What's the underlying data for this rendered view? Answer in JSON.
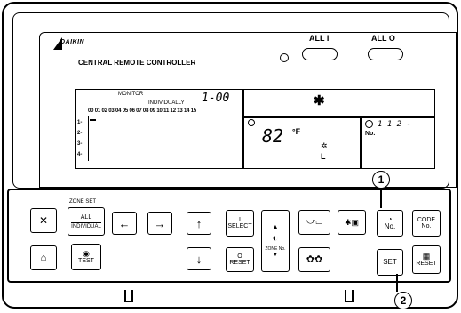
{
  "brand": "DAIKIN",
  "product_title": "CENTRAL REMOTE CONTROLLER",
  "all_on_label": "ALL I",
  "all_off_label": "ALL O",
  "lcd": {
    "monitor_label": "MONITOR",
    "individually_label": "INDIVIDUALLY",
    "group_display": "1-00",
    "zone_numbers": "00 01 02 03 04 05 06 07 08 09 10 11 12 13 14 15",
    "rows": [
      "1-",
      "2-",
      "3-",
      "4-"
    ],
    "star": "✱",
    "temperature": "82",
    "temp_unit": "°F",
    "fan_level": "L",
    "no_label": "No.",
    "program_display": "1  1 2 -"
  },
  "buttons": {
    "zone_set_title": "ZONE SET",
    "all_label": "ALL",
    "individual_label": "INDIVIDUAL",
    "test_label": "TEST",
    "left_arrow": "←",
    "right_arrow": "→",
    "up_arrow": "↑",
    "down_arrow": "↓",
    "select_label": "SELECT",
    "select_mark": "I",
    "reset_label": "RESET",
    "reset_mark": "O",
    "zone_no_label": "ZONE No.",
    "up_tri": "▲",
    "down_tri": "▼",
    "no_label": "No.",
    "code_label": "CODE",
    "code_no_label": "No.",
    "set_label": "SET",
    "reset2_label": "RESET"
  },
  "callouts": [
    "1",
    "2"
  ]
}
